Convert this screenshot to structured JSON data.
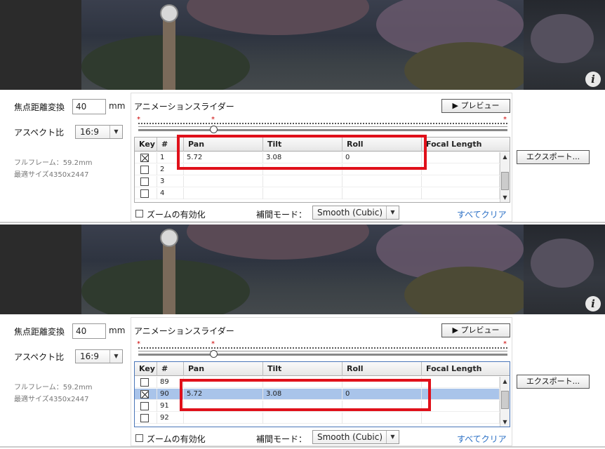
{
  "panels": [
    {
      "focal_label": "焦点距離変換",
      "focal_value": "40",
      "focal_unit": "mm",
      "aspect_label": "アスペクト比",
      "aspect_value": "16:9",
      "fullframe": "フルフレーム：59.2mm",
      "optimal_size": "最適サイズ4350x2447",
      "anim_title": "アニメーションスライダー",
      "preview_label": "▶ プレビュー",
      "columns": [
        "Key",
        "#",
        "Pan",
        "Tilt",
        "Roll",
        "Focal Length"
      ],
      "rows": [
        {
          "key": true,
          "n": "1",
          "pan": "5.72",
          "tilt": "3.08",
          "roll": "0",
          "focal": "",
          "sel": false
        },
        {
          "key": false,
          "n": "2",
          "pan": "",
          "tilt": "",
          "roll": "",
          "focal": "",
          "sel": false
        },
        {
          "key": false,
          "n": "3",
          "pan": "",
          "tilt": "",
          "roll": "",
          "focal": "",
          "sel": false
        },
        {
          "key": false,
          "n": "4",
          "pan": "",
          "tilt": "",
          "roll": "",
          "focal": "",
          "sel": false
        }
      ],
      "zoom_label": "ズームの有効化",
      "interp_label": "補間モード：",
      "interp_value": "Smooth (Cubic)",
      "clear_label": "すべてクリア",
      "export_label": "エクスポート..."
    },
    {
      "focal_label": "焦点距離変換",
      "focal_value": "40",
      "focal_unit": "mm",
      "aspect_label": "アスペクト比",
      "aspect_value": "16:9",
      "fullframe": "フルフレーム：59.2mm",
      "optimal_size": "最適サイズ4350x2447",
      "anim_title": "アニメーションスライダー",
      "preview_label": "▶ プレビュー",
      "columns": [
        "Key",
        "#",
        "Pan",
        "Tilt",
        "Roll",
        "Focal Length"
      ],
      "rows": [
        {
          "key": false,
          "n": "89",
          "pan": "",
          "tilt": "",
          "roll": "",
          "focal": "",
          "sel": false
        },
        {
          "key": true,
          "n": "90",
          "pan": "5.72",
          "tilt": "3.08",
          "roll": "0",
          "focal": "",
          "sel": true
        },
        {
          "key": false,
          "n": "91",
          "pan": "",
          "tilt": "",
          "roll": "",
          "focal": "",
          "sel": false
        },
        {
          "key": false,
          "n": "92",
          "pan": "",
          "tilt": "",
          "roll": "",
          "focal": "",
          "sel": false
        }
      ],
      "zoom_label": "ズームの有効化",
      "interp_label": "補間モード：",
      "interp_value": "Smooth (Cubic)",
      "clear_label": "すべてクリア",
      "export_label": "エクスポート..."
    }
  ],
  "colors": {
    "accent_red": "#e0101a",
    "selection": "#a9c4ea",
    "link": "#2a6fc5"
  }
}
